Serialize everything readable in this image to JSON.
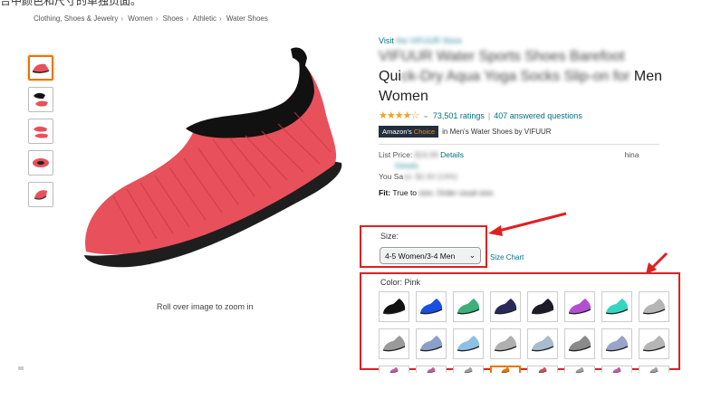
{
  "caption": "合中颜色和尺寸的单独页面。",
  "breadcrumb": [
    "Clothing, Shoes & Jewelry",
    "Women",
    "Shoes",
    "Athletic",
    "Water Shoes"
  ],
  "thumbnails": [
    {
      "name": "thumb-pink-side",
      "color": "#e8505b",
      "selected": true
    },
    {
      "name": "thumb-black-pair",
      "color": "#e8505b"
    },
    {
      "name": "thumb-pink-pair",
      "color": "#e8505b"
    },
    {
      "name": "thumb-pink-top",
      "color": "#e8505b"
    },
    {
      "name": "thumb-pink-sole",
      "color": "#e8505b"
    }
  ],
  "zoom_hint": "Roll over image to zoom in",
  "product": {
    "visit_prefix": "Visit ",
    "visit_blurred": "the VIFUUR Store",
    "title_line1": "VIFUUR Water Sports Shoes Barefoot",
    "title_line2_clear": "Qui",
    "title_line2_blur": "ck-Dry Aqua Yoga Socks Slip-on for",
    "title_line2_end": " Men",
    "title_line3": "Women",
    "stars": "★★★★☆",
    "ratings": "73,501 ratings",
    "answered": "407 answered questions",
    "badge_left": "Amazon's",
    "badge_right": "Choice",
    "choice_text": "in Men's Water Shoes by VIFUUR",
    "list_price_label": "List Price:",
    "list_price_blur": "$16.99",
    "details": "Details",
    "china_text": "hina",
    "you_save_clear": "You Sa",
    "you_save_blur": "ve: $2.40",
    "you_save_pct": "(14%)",
    "fit_label": "Fit:",
    "fit_text": " True to",
    "fit_blur": " size. Order usual size."
  },
  "size": {
    "label": "Size:",
    "selected": "4-5 Women/3-4 Men",
    "chart_link": "Size Chart"
  },
  "color": {
    "label": "Color: Pink",
    "swatches_row1": [
      "#111111",
      "#1a4fe0",
      "#3bb07a",
      "#2a2a5a",
      "#1c1c28",
      "#b24fd0",
      "#35d6c0",
      "#b5b5b5"
    ],
    "swatches_row2": [
      "#9a9a9a",
      "#8aa0c8",
      "#8ec0e6",
      "#b0b0b0",
      "#a8bcd0",
      "#8a8a8a",
      "#9aa4c8",
      "#b5b5b5"
    ],
    "swatches_row3": [
      "#c060a0",
      "#c060a0",
      "#a0a0a0",
      "#e77600",
      "#d05050",
      "#a0a0a0",
      "#c060a0",
      "#a0a0a0"
    ]
  },
  "colors": {
    "link": "#007185",
    "highlight": "#e02020",
    "selected": "#e77600",
    "shoe": "#e8505b"
  }
}
